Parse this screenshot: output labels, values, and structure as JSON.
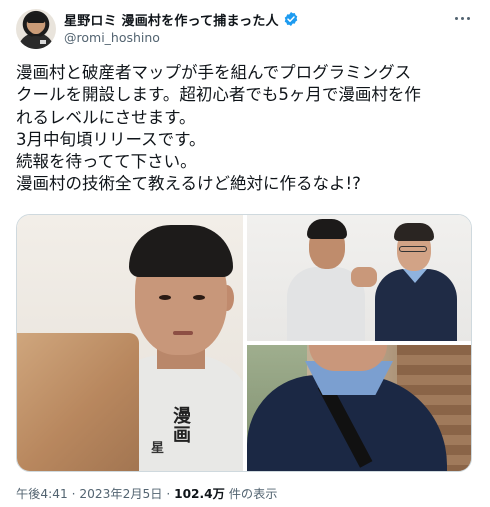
{
  "user": {
    "display_name": "星野ロミ 漫画村を作って捕まった人",
    "handle": "@romi_hoshino",
    "verified_icon": "verified-badge-icon",
    "badge_color": "#1d9bf0"
  },
  "tweet": {
    "lines": [
      "漫画村と破産者マップが手を組んでプログラミングス",
      "クールを開設します。超初心者でも5ヶ月で漫画村を作",
      "れるレベルにさせます。",
      "3月中旬頃リリースです。",
      "続報を待ってて下さい。",
      "漫画村の技術全て教えるけど絶対に作るなよ!?"
    ]
  },
  "media": {
    "photo1_text": "漫画",
    "photo1_text2": "星"
  },
  "footer": {
    "time": "午後4:41",
    "separator": " · ",
    "date": "2023年2月5日",
    "views": "102.4万",
    "views_label": " 件の表示"
  },
  "colors": {
    "text": "#0f1419",
    "secondary": "#536471",
    "border": "#cfd9de"
  }
}
